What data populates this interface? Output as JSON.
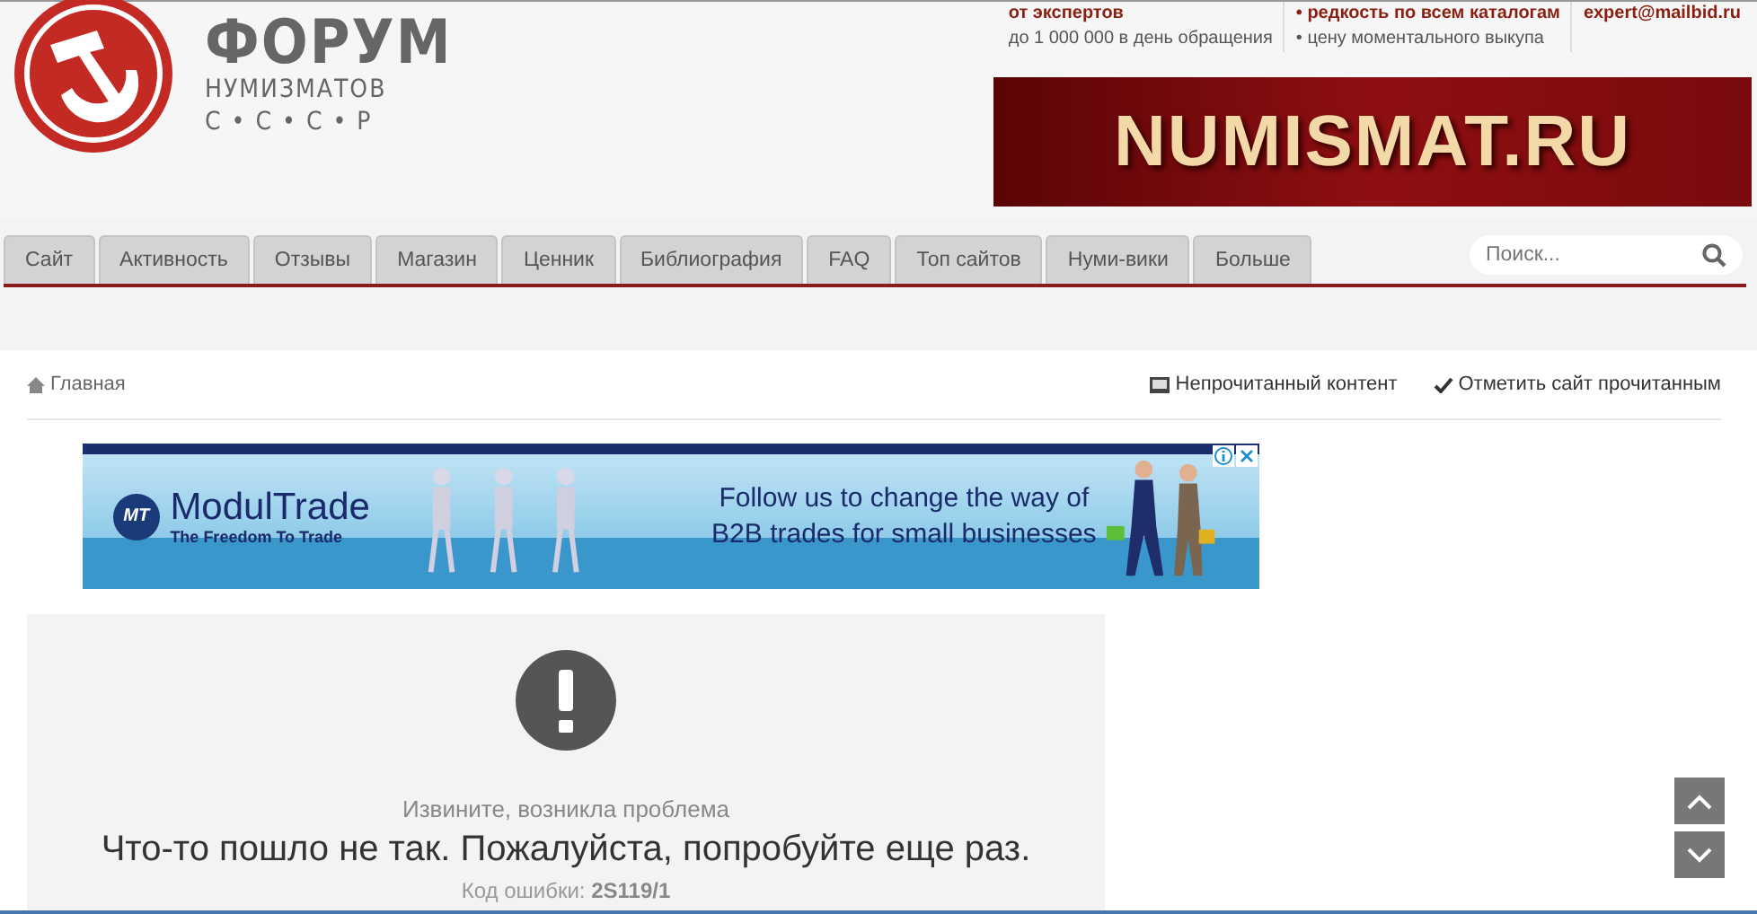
{
  "header": {
    "logo": {
      "title": "ФОРУМ",
      "subtitle": "НУМИЗМАТОВ",
      "letters": "С • С • С • Р"
    },
    "info_columns": [
      {
        "lines": [
          "от экспертов",
          "до 1 000 000 в день обращения"
        ]
      },
      {
        "lines": [
          "• редкость по всем каталогам",
          "• цену моментального выкупа"
        ]
      },
      {
        "lines": [
          "expert@mailbid.ru"
        ]
      }
    ],
    "banner": {
      "text": "NUMISMAT.RU"
    }
  },
  "nav": {
    "tabs": [
      {
        "label": "Сайт",
        "selected": false
      },
      {
        "label": "Активность",
        "selected": false
      },
      {
        "label": "Отзывы",
        "selected": false
      },
      {
        "label": "Магазин",
        "selected": false
      },
      {
        "label": "Ценник",
        "selected": false
      },
      {
        "label": "Библиография",
        "selected": false
      },
      {
        "label": "FAQ",
        "selected": false
      },
      {
        "label": "Топ сайтов",
        "selected": false
      },
      {
        "label": "Нуми-вики",
        "selected": false
      },
      {
        "label": "Больше",
        "selected": false
      }
    ],
    "search": {
      "placeholder": "Поиск..."
    }
  },
  "breadcrumb": {
    "home": "Главная",
    "actions": [
      {
        "kind": "unread",
        "label": "Непрочитанный контент"
      },
      {
        "kind": "mark",
        "label": "Отметить сайт прочитанным"
      }
    ]
  },
  "ad": {
    "logo_mark": "MT",
    "brand": "ModulTrade",
    "tagline": "The Freedom To Trade",
    "headline": "Follow us to change the way of B2B trades for small businesses"
  },
  "error": {
    "intro": "Извините, возникла проблема",
    "message": "Что-то пошло не так. Пожалуйста, попробуйте еще раз.",
    "code_label": "Код ошибки:",
    "code": "2S119/1"
  }
}
